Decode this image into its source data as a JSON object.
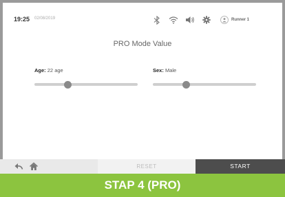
{
  "status_bar": {
    "time": "19:25",
    "date": "02/08/2019",
    "icons": [
      "bluetooth-icon",
      "wifi-icon",
      "volume-icon",
      "settings-gear-icon",
      "user-avatar-icon"
    ],
    "runner_label": "Runner 1"
  },
  "page": {
    "title": "PRO Mode Value"
  },
  "fields": {
    "age": {
      "label": "Age",
      "value": "22 age",
      "level": 0.32
    },
    "sex": {
      "label": "Sex",
      "value": "Male",
      "level": 0.32
    }
  },
  "bottom_bar": {
    "back_icon": "back-arrow-icon",
    "home_icon": "home-icon",
    "reset_label": "RESET",
    "start_label": "START"
  },
  "banner": {
    "text": "STAP 4 (PRO)"
  },
  "colors": {
    "banner": "#8cc43f",
    "start_button": "#4d4d4d",
    "slider_track": "#cfcfcf",
    "slider_knob": "#8a8a8a"
  }
}
